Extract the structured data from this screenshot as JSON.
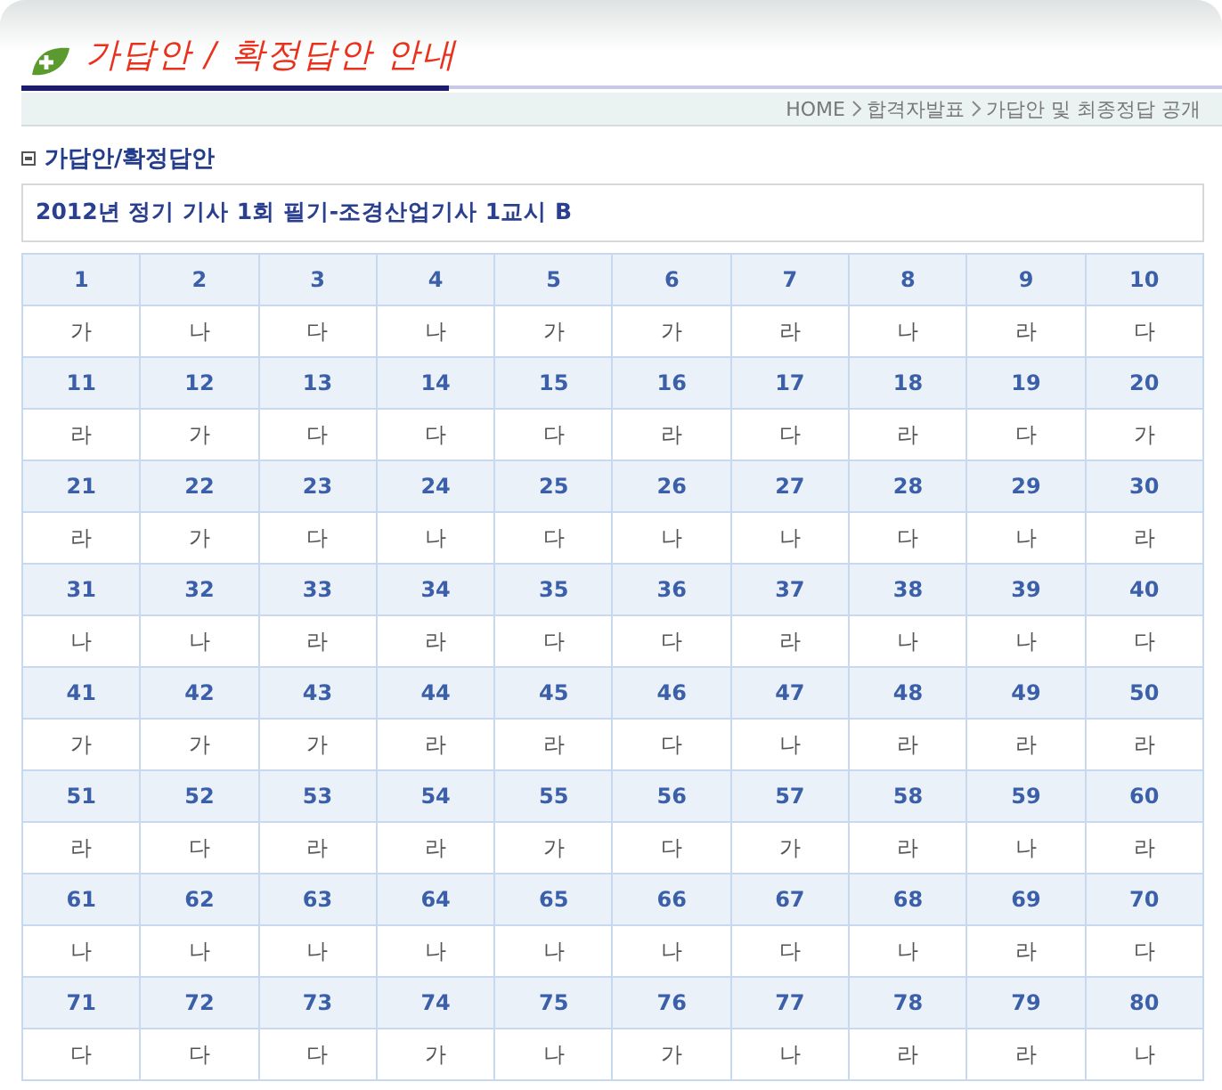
{
  "header": {
    "title": "가답안 / 확정답안 안내"
  },
  "breadcrumb": [
    "HOME",
    "합격자발표",
    "가답안 및 최종정답 공개"
  ],
  "section_title": "가답안/확정답안",
  "exam_title": "2012년 정기 기사 1회 필기-조경산업기사 1교시 B",
  "answer_rows": [
    {
      "numbers": [
        "1",
        "2",
        "3",
        "4",
        "5",
        "6",
        "7",
        "8",
        "9",
        "10"
      ],
      "answers": [
        "가",
        "나",
        "다",
        "나",
        "가",
        "가",
        "라",
        "나",
        "라",
        "다"
      ]
    },
    {
      "numbers": [
        "11",
        "12",
        "13",
        "14",
        "15",
        "16",
        "17",
        "18",
        "19",
        "20"
      ],
      "answers": [
        "라",
        "가",
        "다",
        "다",
        "다",
        "라",
        "다",
        "라",
        "다",
        "가"
      ]
    },
    {
      "numbers": [
        "21",
        "22",
        "23",
        "24",
        "25",
        "26",
        "27",
        "28",
        "29",
        "30"
      ],
      "answers": [
        "라",
        "가",
        "다",
        "나",
        "다",
        "나",
        "나",
        "다",
        "나",
        "라"
      ]
    },
    {
      "numbers": [
        "31",
        "32",
        "33",
        "34",
        "35",
        "36",
        "37",
        "38",
        "39",
        "40"
      ],
      "answers": [
        "나",
        "나",
        "라",
        "라",
        "다",
        "다",
        "라",
        "나",
        "나",
        "다"
      ]
    },
    {
      "numbers": [
        "41",
        "42",
        "43",
        "44",
        "45",
        "46",
        "47",
        "48",
        "49",
        "50"
      ],
      "answers": [
        "가",
        "가",
        "가",
        "라",
        "라",
        "다",
        "나",
        "라",
        "라",
        "라"
      ]
    },
    {
      "numbers": [
        "51",
        "52",
        "53",
        "54",
        "55",
        "56",
        "57",
        "58",
        "59",
        "60"
      ],
      "answers": [
        "라",
        "다",
        "라",
        "라",
        "가",
        "다",
        "가",
        "라",
        "나",
        "라"
      ]
    },
    {
      "numbers": [
        "61",
        "62",
        "63",
        "64",
        "65",
        "66",
        "67",
        "68",
        "69",
        "70"
      ],
      "answers": [
        "나",
        "나",
        "나",
        "나",
        "나",
        "나",
        "다",
        "나",
        "라",
        "다"
      ]
    },
    {
      "numbers": [
        "71",
        "72",
        "73",
        "74",
        "75",
        "76",
        "77",
        "78",
        "79",
        "80"
      ],
      "answers": [
        "다",
        "다",
        "다",
        "가",
        "나",
        "가",
        "나",
        "라",
        "라",
        "나"
      ]
    }
  ]
}
